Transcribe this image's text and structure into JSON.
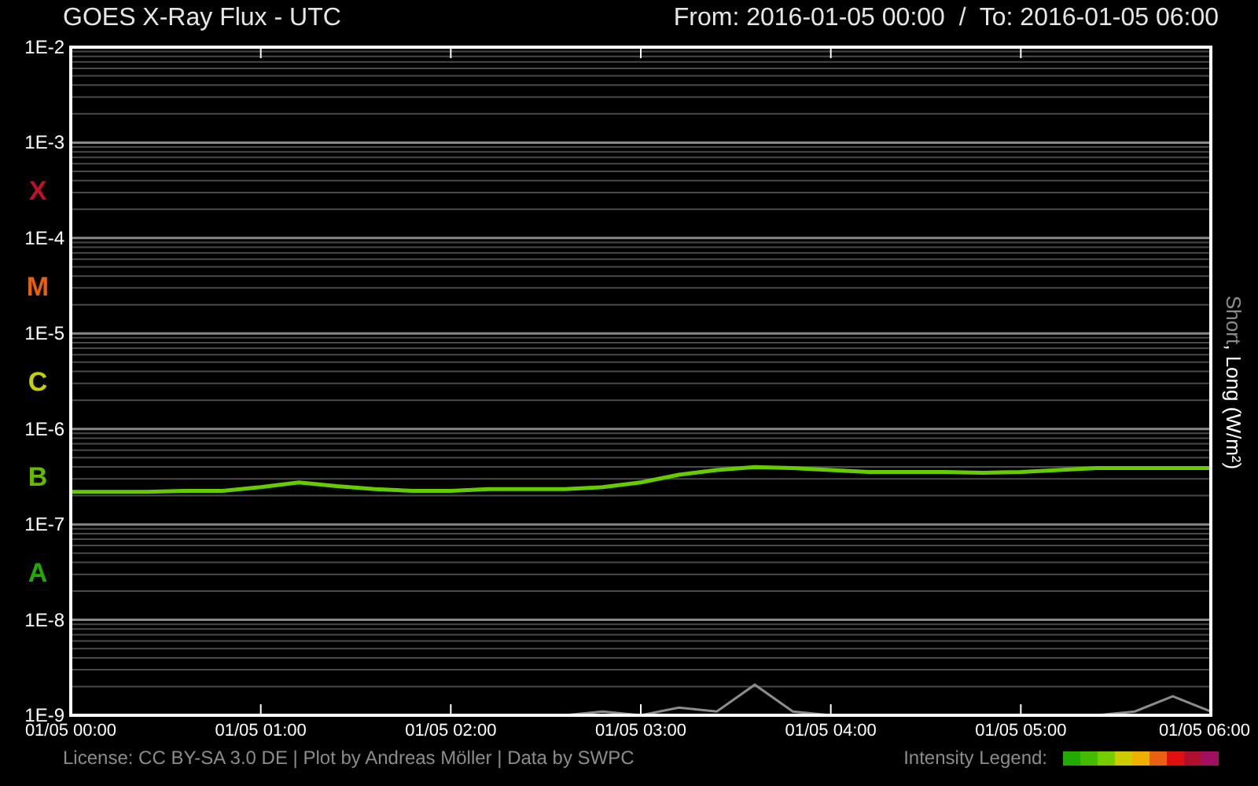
{
  "header": {
    "title": "GOES X-Ray Flux - UTC",
    "range": "From: 2016-01-05 00:00  /  To: 2016-01-05 06:00"
  },
  "plot": {
    "flare_classes": [
      {
        "label": "X",
        "color": "#c0102a"
      },
      {
        "label": "M",
        "color": "#e8600a"
      },
      {
        "label": "C",
        "color": "#c8d000"
      },
      {
        "label": "B",
        "color": "#66bb00"
      },
      {
        "label": "A",
        "color": "#22aa00"
      }
    ],
    "axis_label": {
      "separator": ", ",
      "unit": "(W/m²)"
    },
    "series": [
      {
        "name": "Short",
        "color": "#8c8c8c"
      },
      {
        "name": "Long",
        "color": "#66cc00"
      }
    ],
    "y_axis_labels": [
      "1E-2",
      "1E-3",
      "1E-4",
      "1E-5",
      "1E-6",
      "1E-7",
      "1E-8",
      "1E-9"
    ],
    "x_axis_labels": [
      "01/05 00:00",
      "01/05 01:00",
      "01/05 02:00",
      "01/05 03:00",
      "01/05 04:00",
      "01/05 05:00",
      "01/05 06:00"
    ]
  },
  "footer": {
    "credits": "License: CC BY-SA 3.0 DE | Plot by Andreas Möller | Data by SWPC",
    "legend_label": "Intensity Legend:",
    "legend_swatches": [
      {
        "color": "#22aa00"
      },
      {
        "color": "#44bb00"
      },
      {
        "color": "#77cc00"
      },
      {
        "color": "#cccc00"
      },
      {
        "color": "#f0b000"
      },
      {
        "color": "#e86010"
      },
      {
        "color": "#e01010"
      },
      {
        "color": "#b01030"
      },
      {
        "color": "#a01060"
      }
    ]
  }
}
